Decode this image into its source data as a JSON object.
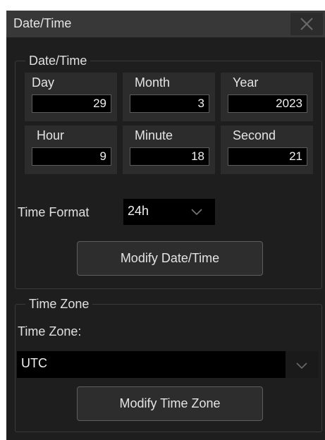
{
  "dialog": {
    "title": "Date/Time"
  },
  "datetime_group": {
    "legend": "Date/Time",
    "fields": [
      {
        "label": "Day",
        "value": "29"
      },
      {
        "label": "Month",
        "value": "3"
      },
      {
        "label": "Year",
        "value": "2023"
      },
      {
        "label": "Hour",
        "value": "9"
      },
      {
        "label": "Minute",
        "value": "18"
      },
      {
        "label": "Second",
        "value": "21"
      }
    ],
    "time_format_label": "Time Format",
    "time_format_value": "24h",
    "modify_button": "Modify Date/Time"
  },
  "timezone_group": {
    "legend": "Time Zone",
    "label": "Time Zone:",
    "value": "UTC",
    "modify_button": "Modify Time Zone"
  },
  "colors": {
    "background": "#1e1e1e",
    "titlebar": "#383838",
    "input_bg": "#000000",
    "text": "#e4e4e4"
  },
  "icons": {
    "close": "close-icon",
    "dropdown": "chevron-down-icon"
  }
}
